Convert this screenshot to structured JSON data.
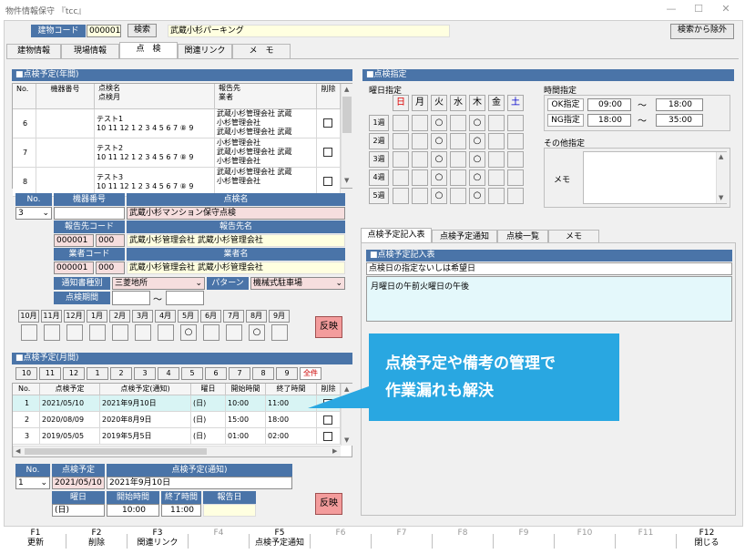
{
  "window": {
    "title": "物件情報保守 『tcc』",
    "min": "—",
    "max": "☐",
    "close": "✕"
  },
  "header": {
    "building_code_label": "建物コード",
    "building_code": "000001",
    "search_label": "検索",
    "building_name": "武蔵小杉パーキング",
    "exclude_label": "検索から除外"
  },
  "tabs": [
    "建物情報",
    "現場情報",
    "点　検",
    "関連リンク",
    "メ　モ"
  ],
  "yearly": {
    "title": "■点検予定(年間)",
    "headers": {
      "no": "No.",
      "device": "機器番号",
      "name": "点検名\n点検月",
      "reporter": "報告先\n業者",
      "delete": "削除"
    },
    "rows": [
      {
        "no": "6",
        "name": "テスト1\n10 11 12 1 2 3 4 5 6 7 ⑧ 9",
        "reporter": "武蔵小杉管理会社 武蔵\n小杉管理会社\n武蔵小杉管理会社 武蔵"
      },
      {
        "no": "7",
        "name": "テスト2\n10 11 12 1 2 3 4 5 6 7 ⑧ 9",
        "reporter": "小杉管理会社\n武蔵小杉管理会社 武蔵\n小杉管理会社"
      },
      {
        "no": "8",
        "name": "テスト3\n10 11 12 1 2 3 4 5 6 7 ⑧ 9",
        "reporter": "武蔵小杉管理会社 武蔵\n小杉管理会社"
      }
    ]
  },
  "detail": {
    "no_label": "No.",
    "device_label": "機器番号",
    "name_label": "点検名",
    "no_value": "3",
    "name_value": "武蔵小杉マンション保守点検",
    "report_code_label": "報告先コード",
    "report_name_label": "報告先名",
    "report_code": "000001",
    "report_sub": "000",
    "report_name": "武蔵小杉管理会社 武蔵小杉管理会社",
    "vendor_code_label": "業者コード",
    "vendor_name_label": "業者名",
    "vendor_code": "000001",
    "vendor_sub": "000",
    "vendor_name": "武蔵小杉管理会社 武蔵小杉管理会社",
    "notice_label": "通知書種別",
    "notice_value": "三菱地所",
    "pattern_label": "パターン",
    "pattern_value": "機械式駐車場",
    "period_label": "点検期間",
    "tilde": "～",
    "months": [
      "10月",
      "11月",
      "12月",
      "1月",
      "2月",
      "3月",
      "4月",
      "5月",
      "6月",
      "7月",
      "8月",
      "9月"
    ],
    "month_marks": [
      "",
      "",
      "",
      "",
      "",
      "",
      "",
      "○",
      "",
      "",
      "○",
      ""
    ],
    "apply": "反映"
  },
  "monthly": {
    "title": "■点検予定(月間)",
    "month_buttons": [
      "10",
      "11",
      "12",
      "1",
      "2",
      "3",
      "4",
      "5",
      "6",
      "7",
      "8",
      "9",
      "全件"
    ],
    "headers": {
      "no": "No.",
      "plan": "点検予定",
      "notice": "点検予定(通知)",
      "dow": "曜日",
      "start": "開始時間",
      "end": "終了時間",
      "delete": "削除"
    },
    "rows": [
      {
        "no": "1",
        "plan": "2021/05/10",
        "notice": "2021年9月10日",
        "dow": "(日)",
        "start": "10:00",
        "end": "11:00"
      },
      {
        "no": "2",
        "plan": "2020/08/09",
        "notice": "2020年8月9日",
        "dow": "(日)",
        "start": "15:00",
        "end": "18:00"
      },
      {
        "no": "3",
        "plan": "2019/05/05",
        "notice": "2019年5月5日",
        "dow": "(日)",
        "start": "01:00",
        "end": "02:00"
      }
    ],
    "detail": {
      "no_label": "No.",
      "plan_label": "点検予定",
      "notice_label": "点検予定(通知)",
      "no": "1",
      "plan": "2021/05/10",
      "notice": "2021年9月10日",
      "dow_label": "曜日",
      "start_label": "開始時間",
      "end_label": "終了時間",
      "report_label": "報告日",
      "dow": "(日)",
      "start": "10:00",
      "end": "11:00"
    },
    "apply": "反映"
  },
  "spec": {
    "title": "■点検指定",
    "day_label": "曜日指定",
    "days": [
      "日",
      "月",
      "火",
      "水",
      "木",
      "金",
      "土"
    ],
    "weeks": [
      "1週",
      "2週",
      "3週",
      "4週",
      "5週"
    ],
    "marks": [
      2,
      4
    ],
    "time_label": "時間指定",
    "ok_label": "OK指定",
    "ok_from": "09:00",
    "ok_to": "18:00",
    "ng_label": "NG指定",
    "ng_from": "18:00",
    "ng_to": "35:00",
    "tilde": "～",
    "other_label": "その他指定",
    "memo_label": "メモ"
  },
  "subtabs": [
    "点検予定記入表",
    "点検予定通知",
    "点検一覧",
    "メモ"
  ],
  "planform": {
    "title": "■点検予定記入表",
    "prompt": "点検日の指定ないしは希望日",
    "value": "月曜日の午前火曜日の午後"
  },
  "callout": {
    "line1": "点検予定や備考の管理で",
    "line2": "作業漏れも解決"
  },
  "fkeys": [
    {
      "key": "F1",
      "label": "更新"
    },
    {
      "key": "F2",
      "label": "削除"
    },
    {
      "key": "F3",
      "label": "関連リンク"
    },
    {
      "key": "F4",
      "label": ""
    },
    {
      "key": "F5",
      "label": "点検予定通知"
    },
    {
      "key": "F6",
      "label": ""
    },
    {
      "key": "F7",
      "label": ""
    },
    {
      "key": "F8",
      "label": ""
    },
    {
      "key": "F9",
      "label": ""
    },
    {
      "key": "F10",
      "label": ""
    },
    {
      "key": "F11",
      "label": ""
    },
    {
      "key": "F12",
      "label": "閉じる"
    }
  ],
  "colors": {
    "accent": "#4a74a8",
    "callout": "#29a7e1",
    "memo_bg": "#e4f8fb",
    "redbtn": "#f39c9c"
  }
}
